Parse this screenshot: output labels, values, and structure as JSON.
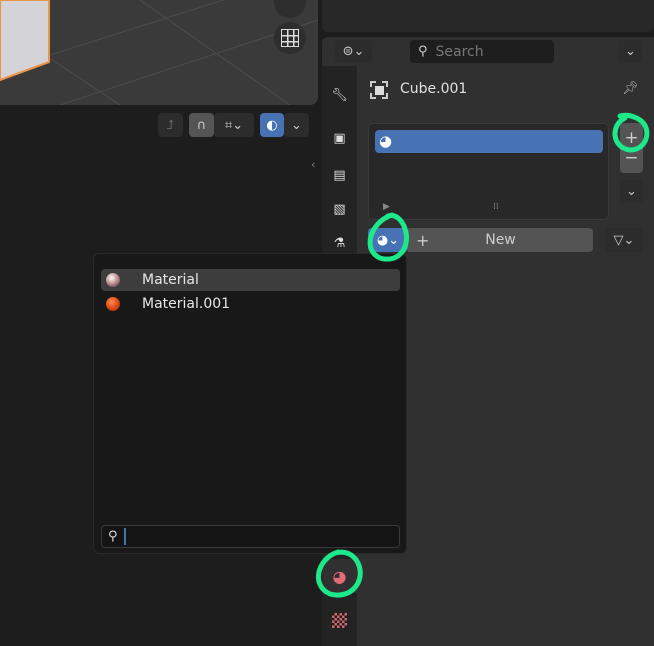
{
  "properties": {
    "search_placeholder": "Search",
    "object_name": "Cube.001",
    "slot_list": [
      {
        "label": ""
      }
    ],
    "new_button_label": "New"
  },
  "material_popup": {
    "items": [
      {
        "label": "Material",
        "selected": true
      },
      {
        "label": "Material.001",
        "selected": false
      }
    ],
    "search_value": ""
  },
  "colors": {
    "accent": "#4772b3",
    "annotation": "#1de98b",
    "selected_edge": "#e8954a"
  }
}
